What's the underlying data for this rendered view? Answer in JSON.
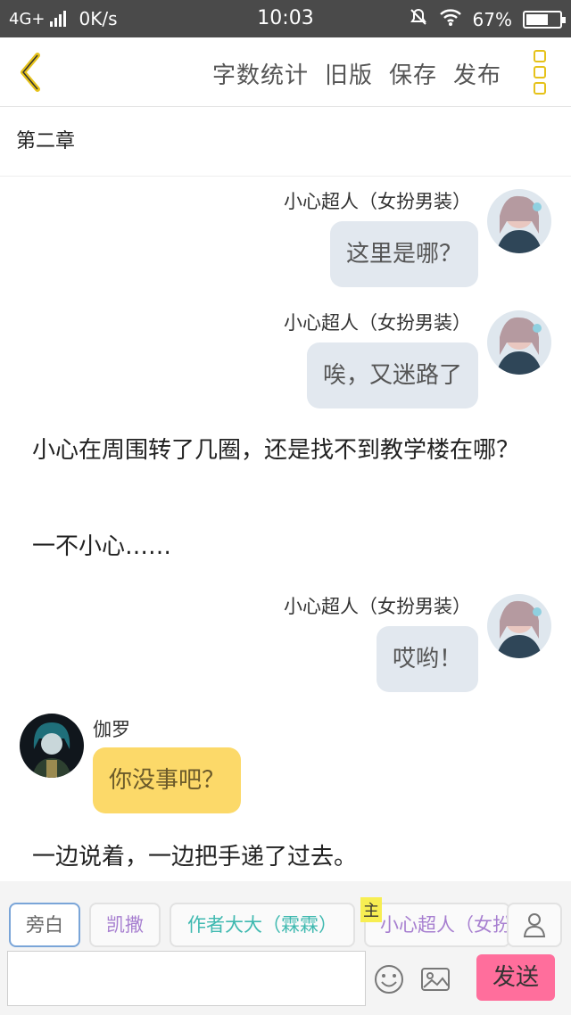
{
  "status_bar": {
    "network": "4G+",
    "speed": "0K/s",
    "time": "10:03",
    "battery": "67%",
    "battery_level": 0.67,
    "icons": [
      "signal-icon",
      "mute-icon",
      "wifi-icon",
      "battery-icon"
    ]
  },
  "top_bar": {
    "back_icon": "back-chevron-icon",
    "actions": [
      "字数统计",
      "旧版",
      "保存",
      "发布"
    ],
    "more_icon": "more-vertical-icon"
  },
  "chapter_title": "第二章",
  "feed": [
    {
      "type": "right",
      "name": "小心超人（女扮男装）",
      "text": "这里是哪？"
    },
    {
      "type": "right",
      "name": "小心超人（女扮男装）",
      "text": "唉，又迷路了"
    },
    {
      "type": "narration",
      "text": "小心在周围转了几圈，还是找不到教学楼在哪？"
    },
    {
      "type": "narration",
      "text": "一不小心……"
    },
    {
      "type": "right",
      "name": "小心超人（女扮男装）",
      "text": "哎哟！"
    },
    {
      "type": "left",
      "name": "伽罗",
      "text": "你没事吧？"
    },
    {
      "type": "narration",
      "text": "一边说着，一边把手递了过去。"
    }
  ],
  "role_chips": [
    "旁白",
    "凯撒",
    "作者大大（霖霖）",
    "小心超人（女扮男装）"
  ],
  "main_tag": "主",
  "composer": {
    "placeholder": "",
    "emoji_icon": "emoji-icon",
    "image_icon": "image-icon",
    "send_label": "发送"
  },
  "colors": {
    "status_bar": "#4a4a4a",
    "accent_yellow": "#e6c21a",
    "right_bubble": "#e2e8ef",
    "left_bubble": "#fcd969",
    "send_button": "#ff6e9c",
    "chip_purple": "#a77fd0",
    "chip_teal": "#3fb9b0",
    "chip_selected_border": "#7aa5d8"
  }
}
